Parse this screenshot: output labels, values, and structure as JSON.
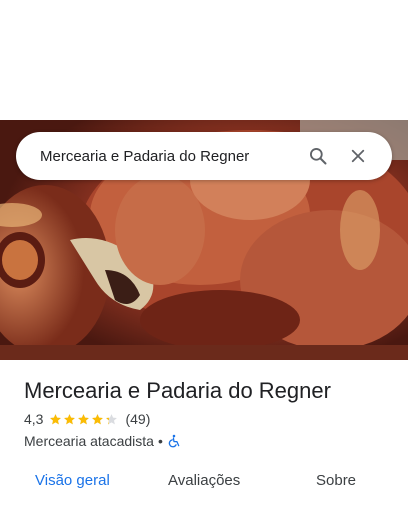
{
  "search": {
    "query": "Mercearia e Padaria do Regner"
  },
  "place": {
    "name": "Mercearia e Padaria do Regner",
    "rating": "4,3",
    "rating_value": 4.3,
    "reviews_count": "(49)",
    "category": "Mercearia atacadista",
    "separator": "•"
  },
  "tabs": [
    {
      "label": "Visão geral",
      "active": true
    },
    {
      "label": "Avaliações",
      "active": false
    },
    {
      "label": "Sobre",
      "active": false
    }
  ],
  "colors": {
    "accent": "#1a73e8",
    "star": "#fbbc04",
    "accessibility": "#1a73e8"
  },
  "icons": {
    "search": "search-icon",
    "close": "close-icon",
    "accessibility": "wheelchair-icon",
    "star": "star-icon"
  }
}
